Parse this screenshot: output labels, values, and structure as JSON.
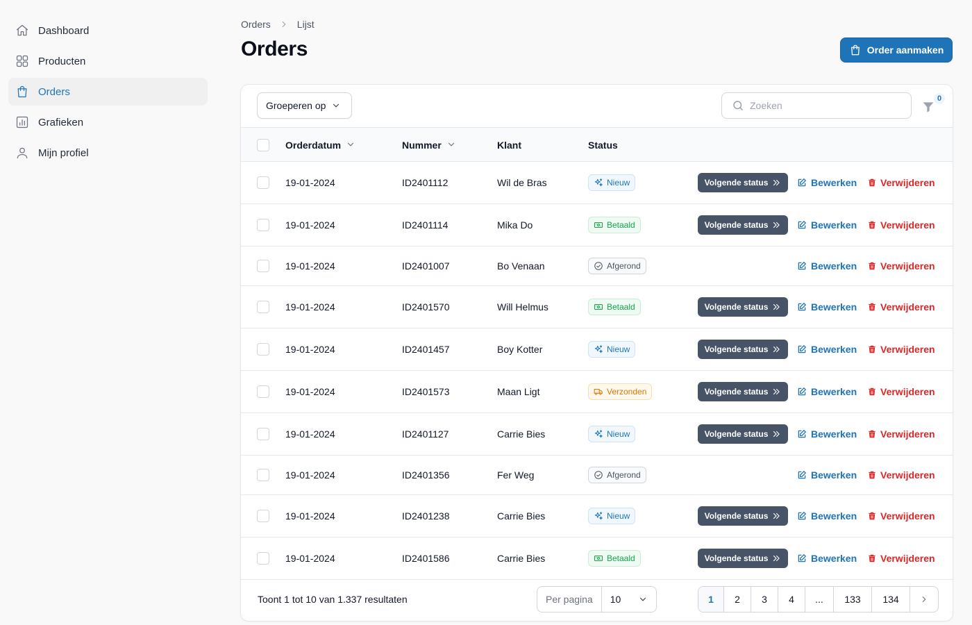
{
  "sidebar": {
    "items": [
      {
        "label": "Dashboard",
        "icon": "home-icon"
      },
      {
        "label": "Producten",
        "icon": "grid-icon"
      },
      {
        "label": "Orders",
        "icon": "shopping-bag-icon",
        "active": true
      },
      {
        "label": "Grafieken",
        "icon": "chart-icon"
      },
      {
        "label": "Mijn profiel",
        "icon": "user-icon"
      }
    ]
  },
  "header": {
    "breadcrumb": [
      "Orders",
      "Lijst"
    ],
    "title": "Orders",
    "create_label": "Order aanmaken"
  },
  "toolbar": {
    "group_label": "Groeperen op",
    "search_placeholder": "Zoeken",
    "filter_count": "0"
  },
  "table": {
    "columns": {
      "date": "Orderdatum",
      "number": "Nummer",
      "client": "Klant",
      "status": "Status"
    },
    "rows": [
      {
        "date": "19-01-2024",
        "number": "ID2401112",
        "client": "Wil de Bras",
        "status": "Nieuw",
        "status_key": "nieuw"
      },
      {
        "date": "19-01-2024",
        "number": "ID2401114",
        "client": "Mika Do",
        "status": "Betaald",
        "status_key": "betaald"
      },
      {
        "date": "19-01-2024",
        "number": "ID2401007",
        "client": "Bo Venaan",
        "status": "Afgerond",
        "status_key": "afgerond"
      },
      {
        "date": "19-01-2024",
        "number": "ID2401570",
        "client": "Will Helmus",
        "status": "Betaald",
        "status_key": "betaald"
      },
      {
        "date": "19-01-2024",
        "number": "ID2401457",
        "client": "Boy Kotter",
        "status": "Nieuw",
        "status_key": "nieuw"
      },
      {
        "date": "19-01-2024",
        "number": "ID2401573",
        "client": "Maan Ligt",
        "status": "Verzonden",
        "status_key": "verzonden"
      },
      {
        "date": "19-01-2024",
        "number": "ID2401127",
        "client": "Carrie Bies",
        "status": "Nieuw",
        "status_key": "nieuw"
      },
      {
        "date": "19-01-2024",
        "number": "ID2401356",
        "client": "Fer Weg",
        "status": "Afgerond",
        "status_key": "afgerond"
      },
      {
        "date": "19-01-2024",
        "number": "ID2401238",
        "client": "Carrie Bies",
        "status": "Nieuw",
        "status_key": "nieuw"
      },
      {
        "date": "19-01-2024",
        "number": "ID2401586",
        "client": "Carrie Bies",
        "status": "Betaald",
        "status_key": "betaald"
      }
    ],
    "actions": {
      "next_status": "Volgende status",
      "edit": "Bewerken",
      "delete": "Verwijderen"
    }
  },
  "footer": {
    "result_text": "Toont 1 tot 10 van 1.337 resultaten",
    "per_page_label": "Per pagina",
    "per_page_value": "10",
    "pages": [
      "1",
      "2",
      "3",
      "4",
      "...",
      "133",
      "134"
    ],
    "current_page": "1"
  },
  "colors": {
    "accent": "#1f74b8",
    "danger": "#dc2626",
    "next_status_bg": "#475467",
    "paid": "#16a34a",
    "shipped": "#d97706"
  }
}
